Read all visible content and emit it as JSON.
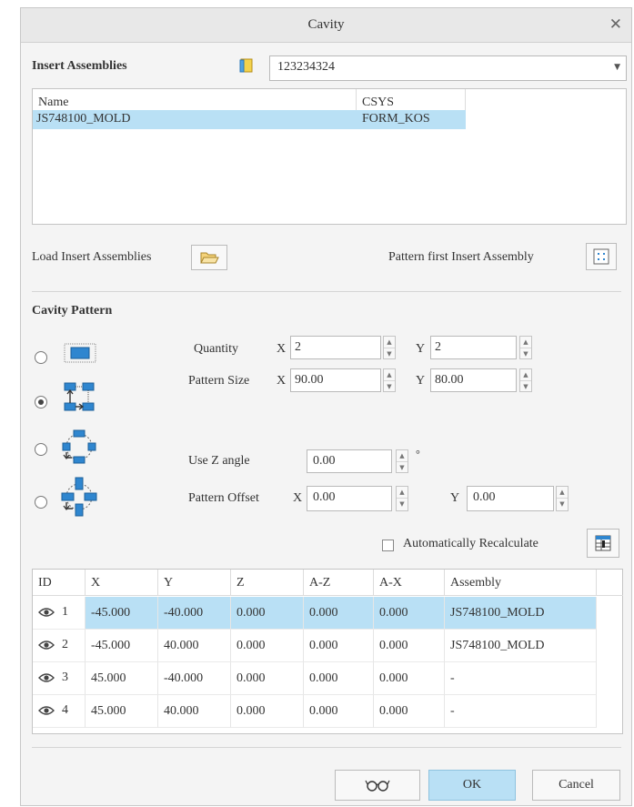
{
  "dialog": {
    "title": "Cavity"
  },
  "insert": {
    "label": "Insert Assemblies",
    "value": "123234324",
    "columns": [
      "Name",
      "CSYS"
    ],
    "rows": [
      {
        "name": "JS748100_MOLD",
        "csys": "FORM_KOS"
      }
    ],
    "load_label": "Load Insert Assemblies",
    "pattern_first_label": "Pattern first Insert Assembly"
  },
  "cavity": {
    "label": "Cavity Pattern",
    "selected_pattern": "rectangular",
    "quantity_label": "Quantity",
    "quantity_x": "2",
    "quantity_y": "2",
    "pattern_size_label": "Pattern Size",
    "size_x": "90.00",
    "size_y": "80.00",
    "x_label": "X",
    "y_label": "Y",
    "use_z_label": "Use Z angle",
    "z_angle": "0.00",
    "degree_symbol": "°",
    "pattern_offset_label": "Pattern Offset",
    "offset_x": "0.00",
    "offset_y": "0.00",
    "auto_recalc_label": "Automatically Recalculate",
    "auto_recalc_checked": false
  },
  "grid": {
    "columns": [
      "ID",
      "X",
      "Y",
      "Z",
      "A-Z",
      "A-X",
      "Assembly"
    ],
    "rows": [
      {
        "id": "1",
        "x": "-45.000",
        "y": "-40.000",
        "z": "0.000",
        "az": "0.000",
        "ax": "0.000",
        "assembly": "JS748100_MOLD",
        "selected": true
      },
      {
        "id": "2",
        "x": "-45.000",
        "y": "40.000",
        "z": "0.000",
        "az": "0.000",
        "ax": "0.000",
        "assembly": "JS748100_MOLD",
        "selected": false
      },
      {
        "id": "3",
        "x": "45.000",
        "y": "-40.000",
        "z": "0.000",
        "az": "0.000",
        "ax": "0.000",
        "assembly": "-",
        "selected": false
      },
      {
        "id": "4",
        "x": "45.000",
        "y": "40.000",
        "z": "0.000",
        "az": "0.000",
        "ax": "0.000",
        "assembly": "-",
        "selected": false
      }
    ]
  },
  "footer": {
    "preview_icon": "glasses-icon",
    "ok_label": "OK",
    "cancel_label": "Cancel"
  },
  "colors": {
    "accent": "#b9e0f5",
    "icon_blue": "#2f86cf",
    "dialog_bg": "#f4f4f4"
  }
}
